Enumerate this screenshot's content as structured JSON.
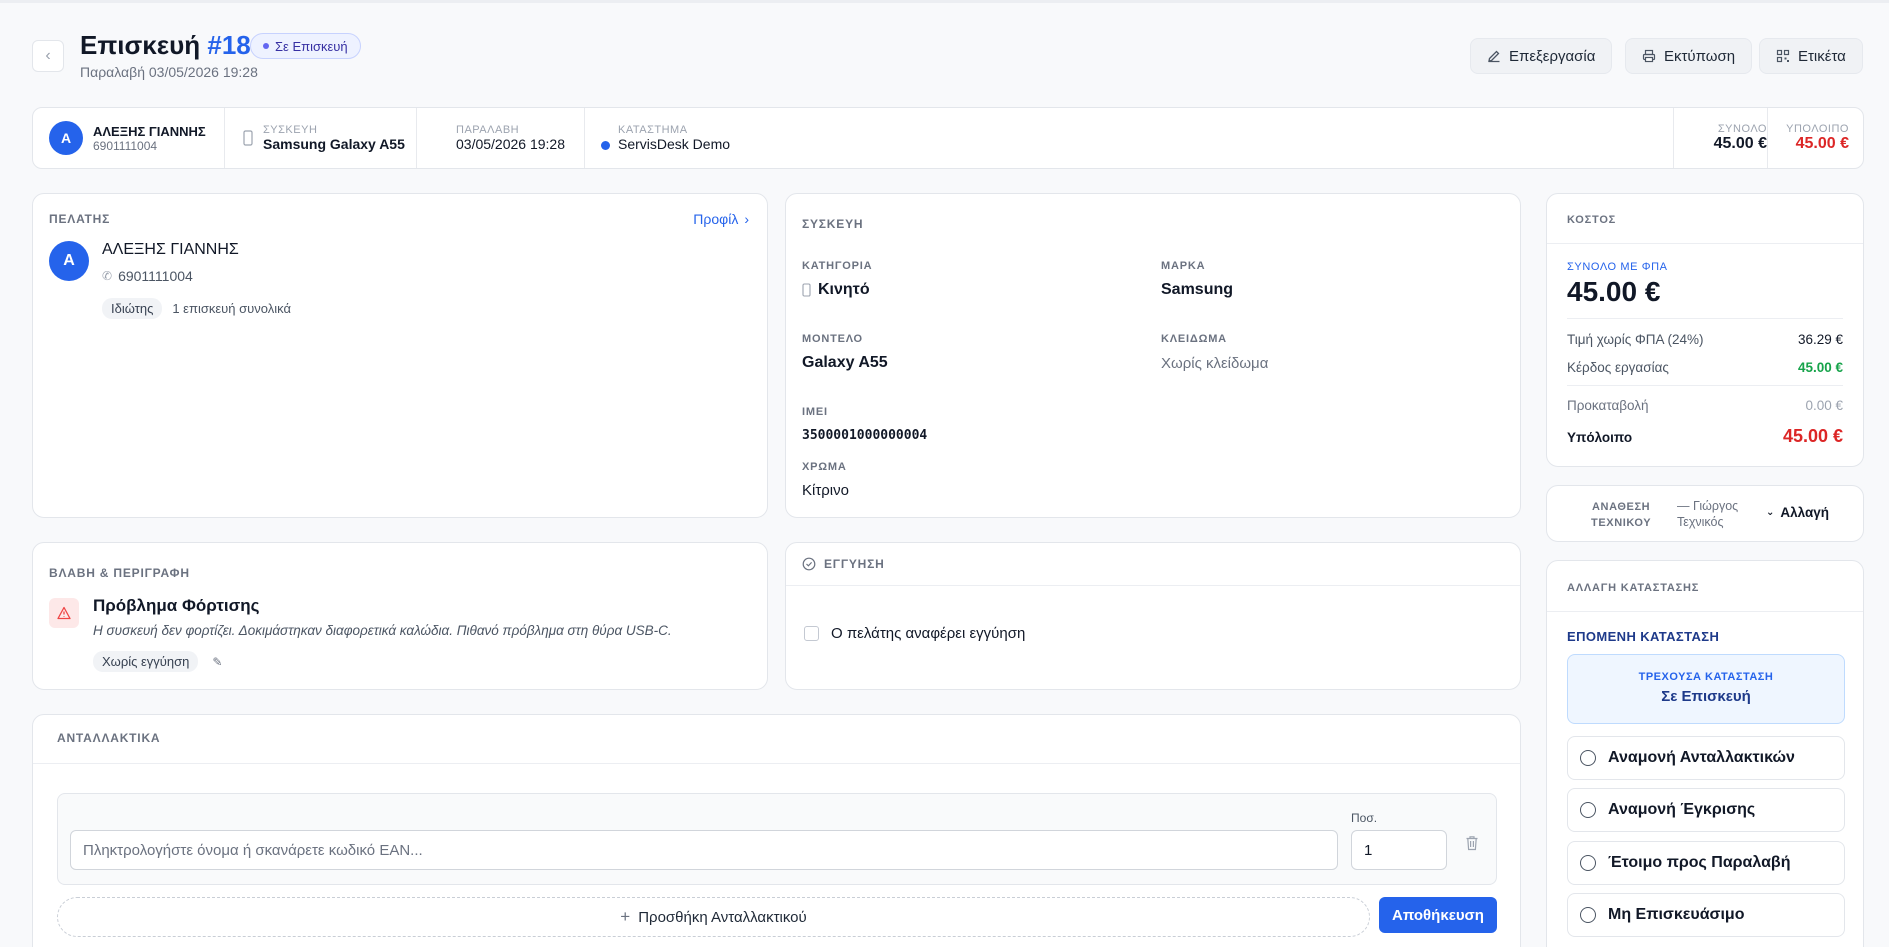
{
  "header": {
    "title_prefix": "Επισκευή",
    "title_number": "#18",
    "status": "Σε Επισκευή",
    "subtitle": "Παραλαβή 03/05/2026 19:28",
    "edit_label": "Επεξεργασία",
    "print_label": "Εκτύπωση",
    "label_label": "Ετικέτα"
  },
  "summary": {
    "avatar": "A",
    "customer_name": "ΑΛΕΞΗΣ ΓΙΑΝΝΗΣ",
    "customer_phone": "6901111004",
    "device_label": "ΣΥΣΚΕΥΗ",
    "device_value": "Samsung Galaxy A55",
    "received_label": "ΠΑΡΑΛΑΒΗ",
    "received_value": "03/05/2026 19:28",
    "store_label": "ΚΑΤΑΣΤΗΜΑ",
    "store_value": "ServisDesk Demo",
    "total_label": "ΣΥΝΟΛΟ",
    "total_value": "45.00 €",
    "balance_label": "ΥΠΟΛΟΙΠΟ",
    "balance_value": "45.00 €"
  },
  "customer": {
    "section": "ΠΕΛΑΤΗΣ",
    "profile_link": "Προφίλ",
    "avatar": "A",
    "name": "ΑΛΕΞΗΣ ΓΙΑΝΝΗΣ",
    "phone": "6901111004",
    "type_tag": "Ιδιώτης",
    "visits": "1 επισκευή συνολικά"
  },
  "device": {
    "section": "ΣΥΣΚΕΥΗ",
    "category_label": "ΚΑΤΗΓΟΡΙΑ",
    "category_value": "Κινητό",
    "brand_label": "ΜΑΡΚΑ",
    "brand_value": "Samsung",
    "model_label": "ΜΟΝΤΕΛΟ",
    "model_value": "Galaxy A55",
    "lock_label": "ΚΛΕΙΔΩΜΑ",
    "lock_value": "Χωρίς κλείδωμα",
    "imei_label": "IMEI",
    "imei_value": "3500001000000004",
    "color_label": "ΧΡΩΜΑ",
    "color_value": "Κίτρινο"
  },
  "fault": {
    "section": "ΒΛΑΒΗ & ΠΕΡΙΓΡΑΦΗ",
    "title": "Πρόβλημα Φόρτισης",
    "description": "Η συσκευή δεν φορτίζει. Δοκιμάστηκαν διαφορετικά καλώδια. Πιθανό πρόβλημα στη θύρα USB-C.",
    "warranty_tag": "Χωρίς εγγύηση"
  },
  "warranty": {
    "section": "ΕΓΓΥΗΣΗ",
    "checkbox_label": "Ο πελάτης αναφέρει εγγύηση"
  },
  "parts": {
    "section": "ΑΝΤΑΛΛΑΚΤΙΚΑ",
    "search_placeholder": "Πληκτρολογήστε όνομα ή σκανάρετε κωδικό EAN...",
    "qty_label": "Ποσ.",
    "qty_value": "1",
    "add_label": "Προσθήκη Ανταλλακτικού",
    "save_label": "Αποθήκευση"
  },
  "cost": {
    "section": "ΚΟΣΤΟΣ",
    "total_vat_label": "ΣΥΝΟΛΟ ΜΕ ΦΠΑ",
    "total_vat_value": "45.00 €",
    "net_label": "Τιμή χωρίς ΦΠΑ (24%)",
    "net_value": "36.29 €",
    "profit_label": "Κέρδος εργασίας",
    "profit_value": "45.00 €",
    "deposit_label": "Προκαταβολή",
    "deposit_value": "0.00 €",
    "balance_label": "Υπόλοιπο",
    "balance_value": "45.00 €"
  },
  "technician": {
    "label_line1": "ΑΝΑΘΕΣΗ",
    "label_line2": "ΤΕΧΝΙΚΟΥ",
    "value_line1": "— Γιώργος",
    "value_line2": "Τεχνικός",
    "change_label": "Αλλαγή"
  },
  "status_change": {
    "section": "ΑΛΛΑΓΗ ΚΑΤΑΣΤΑΣΗΣ",
    "next_label": "ΕΠΟΜΕΝΗ ΚΑΤΑΣΤΑΣΗ",
    "current_label": "ΤΡΕΧΟΥΣΑ ΚΑΤΑΣΤΑΣΗ",
    "current_value": "Σε Επισκευή",
    "options": [
      "Αναμονή Ανταλλακτικών",
      "Αναμονή Έγκρισης",
      "Έτοιμο προς Παραλαβή",
      "Μη Επισκευάσιμο"
    ]
  },
  "colors": {
    "accent": "#2563eb",
    "danger": "#dc2626",
    "success": "#16a34a"
  }
}
